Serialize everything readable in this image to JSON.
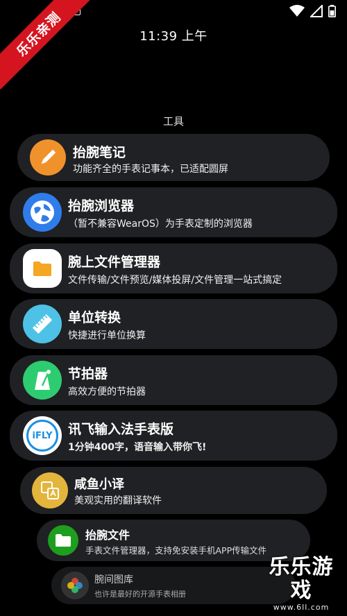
{
  "status_bar": {
    "left_icons": [
      "circle-icon",
      "a-badge-icon"
    ],
    "right_icons": [
      "wifi-icon",
      "signal-icon",
      "battery-icon"
    ]
  },
  "ribbon": {
    "text": "乐乐亲测"
  },
  "clock": {
    "time": "11:39 上午"
  },
  "section": {
    "title": "工具"
  },
  "apps": [
    {
      "name": "抬腕笔记",
      "desc": "功能齐全的手表记事本，已适配圆屏",
      "icon": "pencil-icon",
      "color": "#F0922B"
    },
    {
      "name": "抬腕浏览器",
      "desc": "（暂不兼容WearOS）为手表定制的浏览器",
      "icon": "globe-icon",
      "color": "#2F7DEB"
    },
    {
      "name": "腕上文件管理器",
      "desc": "文件传输/文件预览/媒体投屏/文件管理一站式搞定",
      "icon": "folder-icon",
      "color": "#FFFFFF"
    },
    {
      "name": "单位转换",
      "desc": "快捷进行单位换算",
      "icon": "ruler-icon",
      "color": "#4EC2E6"
    },
    {
      "name": "节拍器",
      "desc": "高效方便的节拍器",
      "icon": "metronome-icon",
      "color": "#2ECC71"
    },
    {
      "name": "讯飞输入法手表版",
      "desc": "1分钟400字，语音输入带你飞!",
      "icon": "ifly-icon",
      "icon_text": "iFLY",
      "color": "#FFFFFF"
    },
    {
      "name": "咸鱼小译",
      "desc": "美观实用的翻译软件",
      "icon": "translate-icon",
      "color": "#E3B53C"
    },
    {
      "name": "抬腕文件",
      "desc": "手表文件管理器，支持免安装手机APP传输文件",
      "icon": "folder-icon",
      "color": "#1E9E1E"
    },
    {
      "name": "腕间图库",
      "desc": "也许是最好的开源手表相册",
      "icon": "gallery-icon",
      "color": "#333333"
    }
  ],
  "watermark": {
    "main": "乐乐游戏",
    "sub": "www.6ll.com"
  }
}
